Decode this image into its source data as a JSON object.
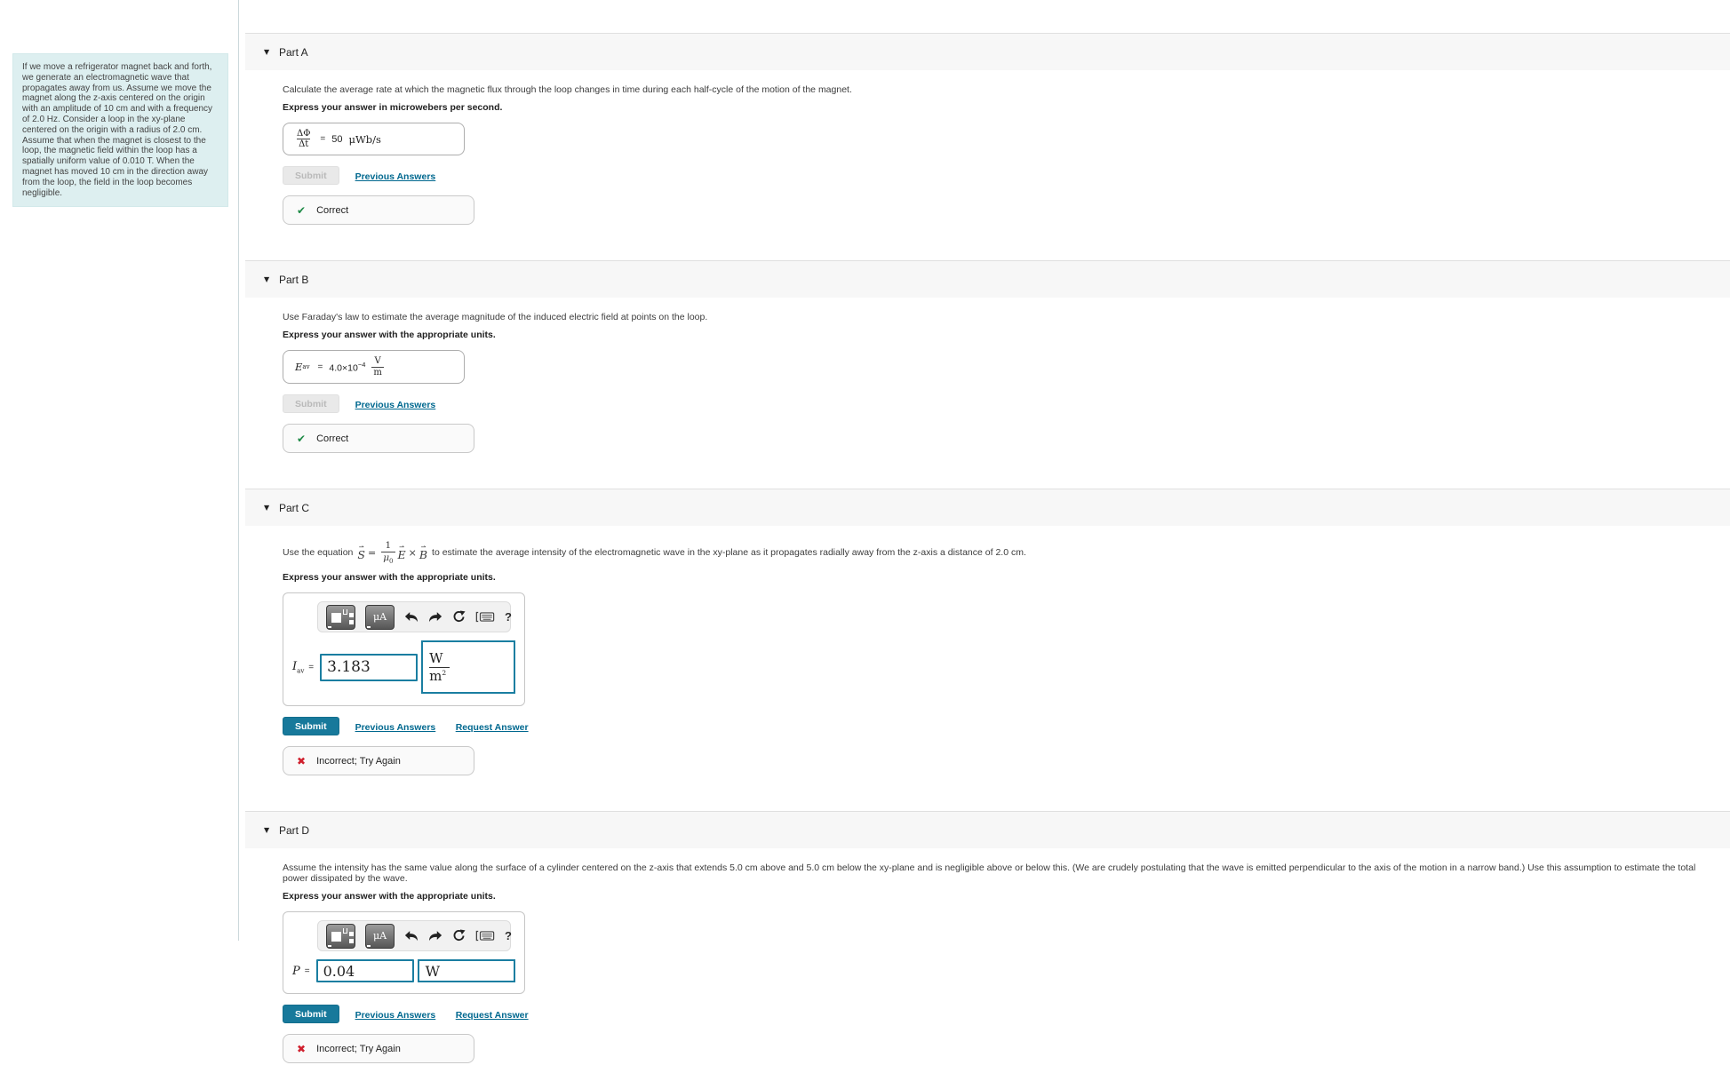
{
  "problem": {
    "statement": "If we move a refrigerator magnet back and forth, we generate an electromagnetic wave that propagates away from us. Assume we move the magnet along the z-axis centered on the origin with an amplitude of 10 cm and with a frequency of 2.0 Hz. Consider a loop in the xy-plane centered on the origin with a radius of 2.0 cm. Assume that when the magnet is closest to the loop, the magnetic field within the loop has a spatially uniform value of 0.010 T. When the magnet has moved 10 cm in the direction away from the loop, the field in the loop becomes negligible."
  },
  "common": {
    "submit": "Submit",
    "previous_answers": "Previous Answers",
    "request_answer": "Request Answer",
    "correct": "Correct",
    "incorrect": "Incorrect; Try Again",
    "check_icon": "✔",
    "cross_icon": "✖",
    "collapse_icon": "▼",
    "help_icon": "?",
    "units_button_label": "μA"
  },
  "parts": {
    "a": {
      "title": "Part A",
      "description": "Calculate the average rate at which the magnetic flux through the loop changes in time during each half-cycle of the motion of the magnet.",
      "express": "Express your answer in microwebers per second.",
      "answer": {
        "frac_top": "ΔΦ",
        "frac_bottom": "Δt",
        "equals": "=",
        "value": "50",
        "units": "μWb/s"
      }
    },
    "b": {
      "title": "Part B",
      "description": "Use Faraday's law to estimate the average magnitude of the induced electric field at points on the loop.",
      "express": "Express your answer with the appropriate units.",
      "answer": {
        "symbol": "E",
        "symbol_sub": "av",
        "equals": "=",
        "value_base": "4.0×10",
        "value_exp": "−4",
        "frac_top": "V",
        "frac_bottom": "m"
      }
    },
    "c": {
      "title": "Part C",
      "description_pre": "Use the equation",
      "equation": {
        "lhs": "S",
        "equals": "=",
        "frac_top": "1",
        "frac_bottom": "μ",
        "frac_bottom_sub": "0",
        "rhs_e": "E",
        "times": "×",
        "rhs_b": "B"
      },
      "description_post": "to estimate the average intensity of the electromagnetic wave in the xy-plane as it propagates radially away from the z-axis a distance of 2.0 cm.",
      "express": "Express your answer with the appropriate units.",
      "answer": {
        "symbol": "I",
        "symbol_sub": "av",
        "equals": "=",
        "value": "3.183",
        "units_top": "W",
        "units_bottom_base": "m",
        "units_bottom_exp": "2"
      }
    },
    "d": {
      "title": "Part D",
      "description": "Assume the intensity has the same value along the surface of a cylinder centered on the z-axis that extends 5.0 cm above and 5.0 cm below the xy-plane and is negligible above or below this. (We are crudely postulating that the wave is emitted perpendicular to the axis of the motion in a narrow band.) Use this assumption to estimate the total power dissipated by the wave.",
      "express": "Express your answer with the appropriate units.",
      "answer": {
        "symbol": "P",
        "equals": "=",
        "value": "0.04",
        "units": "W"
      }
    }
  }
}
